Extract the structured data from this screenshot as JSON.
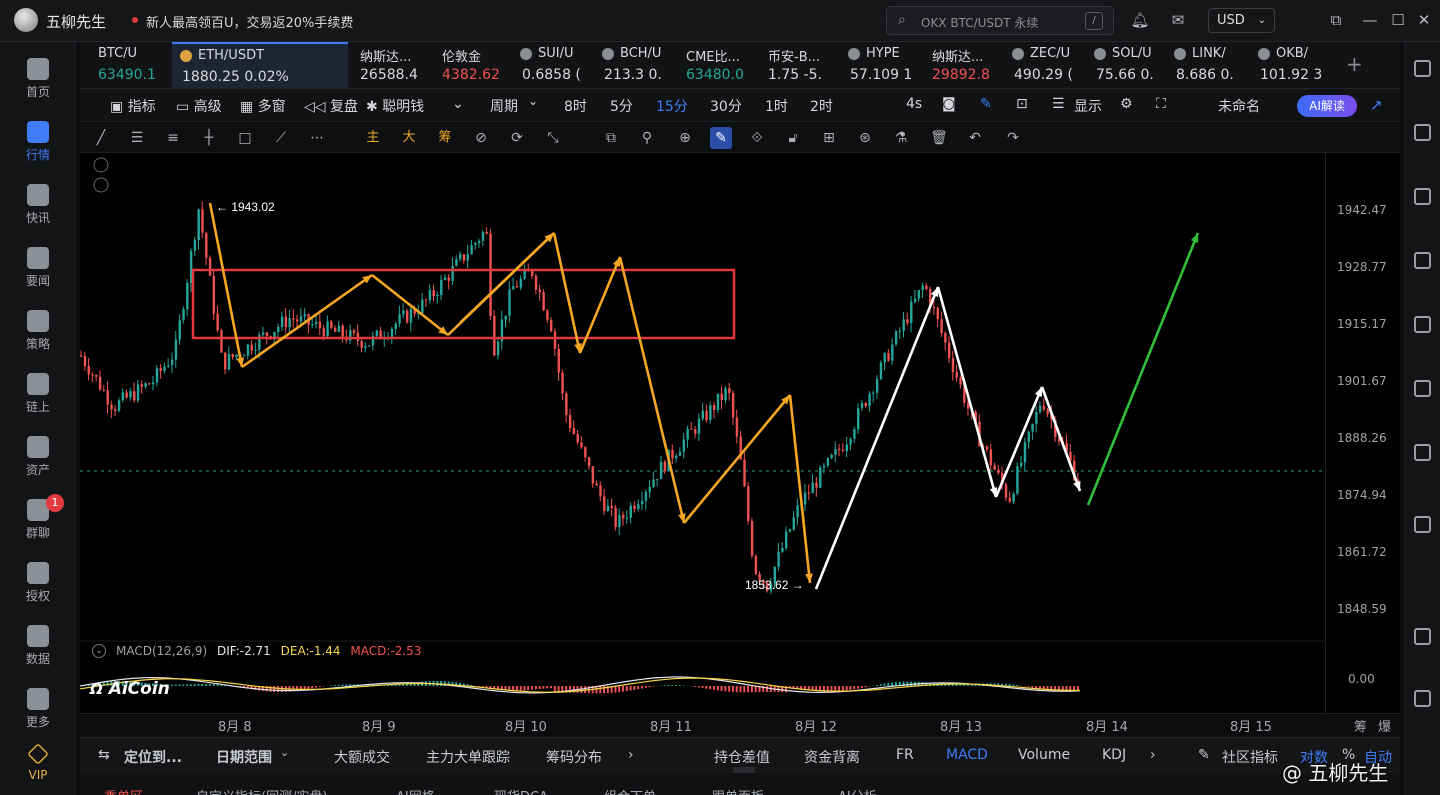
{
  "titlebar": {
    "app_name": "五柳先生",
    "promo": "新人最高领百U，交易返20%手续费",
    "search_placeholder": "OKX BTC/USDT 永续",
    "search_shortcut": "/",
    "currency": "USD"
  },
  "sidebar": [
    {
      "label": "首页",
      "icon": "home-icon"
    },
    {
      "label": "行情",
      "icon": "chart-bars-icon",
      "active": true
    },
    {
      "label": "快讯",
      "icon": "news-icon"
    },
    {
      "label": "要闻",
      "icon": "document-icon"
    },
    {
      "label": "策略",
      "icon": "robot-icon"
    },
    {
      "label": "链上",
      "icon": "chain-icon"
    },
    {
      "label": "资产",
      "icon": "wallet-icon"
    },
    {
      "label": "群聊",
      "icon": "chat-icon",
      "badge": "1"
    },
    {
      "label": "授权",
      "icon": "key-icon"
    },
    {
      "label": "数据",
      "icon": "data-icon"
    },
    {
      "label": "更多",
      "icon": "grid-icon"
    },
    {
      "label": "VIP",
      "icon": "diamond-icon"
    }
  ],
  "tickers": [
    {
      "symbol": "BTC/U",
      "price": "63490.1",
      "color": "#26a69a"
    },
    {
      "symbol": "ETH/USDT",
      "price": "1880.25 0.02%",
      "color": "#d7d9de",
      "active": true
    },
    {
      "symbol": "纳斯达...",
      "price": "26588.4",
      "color": "#d7d9de"
    },
    {
      "symbol": "伦敦金",
      "price": "4382.62",
      "color": "#ef5350"
    },
    {
      "symbol": "SUI/U",
      "price": "0.6858 (",
      "color": "#d7d9de"
    },
    {
      "symbol": "BCH/U",
      "price": "213.3 0.",
      "color": "#d7d9de"
    },
    {
      "symbol": "CME比...",
      "price": "63480.0",
      "color": "#26a69a"
    },
    {
      "symbol": "币安-B...",
      "price": "1.75 -5.",
      "color": "#d7d9de"
    },
    {
      "symbol": "HYPE",
      "price": "57.109 1",
      "color": "#d7d9de"
    },
    {
      "symbol": "纳斯达...",
      "price": "29892.8",
      "color": "#ef5350"
    },
    {
      "symbol": "ZEC/U",
      "price": "490.29 (",
      "color": "#d7d9de"
    },
    {
      "symbol": "SOL/U",
      "price": "75.66 0.",
      "color": "#d7d9de"
    },
    {
      "symbol": "LINK/",
      "price": "8.686 0.",
      "color": "#d7d9de"
    },
    {
      "symbol": "OKB/",
      "price": "101.92 3",
      "color": "#d7d9de"
    }
  ],
  "toolbar": {
    "items": [
      "指标",
      "高级",
      "多窗",
      "复盘",
      "聪明钱"
    ],
    "period_label": "周期",
    "intervals": [
      "8时",
      "5分",
      "15分",
      "30分",
      "1时",
      "2时"
    ],
    "selected_interval": "15分",
    "refresh": "4s",
    "display": "显示",
    "layout_name": "未命名",
    "ai_button": "AI解读"
  },
  "drawing_tools_cn": [
    "主",
    "大",
    "筹"
  ],
  "chart": {
    "symbol": "ETH/USDT",
    "price_ticks": [
      "1942.47",
      "1928.77",
      "1915.17",
      "1901.67",
      "1888.26",
      "1874.94",
      "1861.72",
      "1848.59"
    ],
    "high_label": "← 1943.02",
    "low_label": "1853.62 →",
    "dates": [
      "8月 8",
      "8月 9",
      "8月 10",
      "8月 11",
      "8月 12",
      "8月 13",
      "8月 14",
      "8月 15"
    ],
    "macd": {
      "title": "MACD(12,26,9)",
      "dif": "DIF:-2.71",
      "dea": "DEA:-1.44",
      "macd": "MACD:-2.53",
      "zero": "0.00"
    },
    "colors": {
      "up": "#26a69a",
      "down": "#ef5350",
      "yellow_wave": "#f5a623",
      "white_wave": "#ffffff",
      "green_arrow": "#2fbf3a",
      "box": "#e0393e"
    }
  },
  "chart_data": {
    "type": "candlestick",
    "x": [
      "8月 8",
      "8月 9",
      "8月 10",
      "8月 11",
      "8月 12",
      "8月 13",
      "8月 14"
    ],
    "close": [
      1905,
      1916,
      1918,
      1880,
      1874,
      1893,
      1878
    ],
    "high": [
      1943.02,
      1925,
      1938,
      1915,
      1898,
      1925,
      1895
    ],
    "low": [
      1896,
      1909,
      1905,
      1866,
      1853.62,
      1872,
      1874
    ],
    "ylim": [
      1845,
      1950
    ]
  },
  "corner_labels": {
    "right_a": "筹",
    "right_b": "爆"
  },
  "bottombar": {
    "locate": "定位到...",
    "date_range": "日期范围",
    "items": [
      "大额成交",
      "主力大单跟踪",
      "筹码分布"
    ],
    "right_items": [
      "持仓差值",
      "资金背离",
      "FR",
      "MACD",
      "Volume",
      "KDJ"
    ],
    "selected": "MACD",
    "community": "社区指标",
    "more": "对数",
    "pct": "%",
    "auto": "自动"
  },
  "bottom_tabs": [
    "委单区",
    "自定义指标(回测/实盘)",
    "AI网格",
    "现货DCA",
    "组合下单",
    "跟单面板",
    "AI分析"
  ],
  "brand": {
    "aicoin": "AiCoin",
    "watermark": "@ 五柳先生"
  }
}
